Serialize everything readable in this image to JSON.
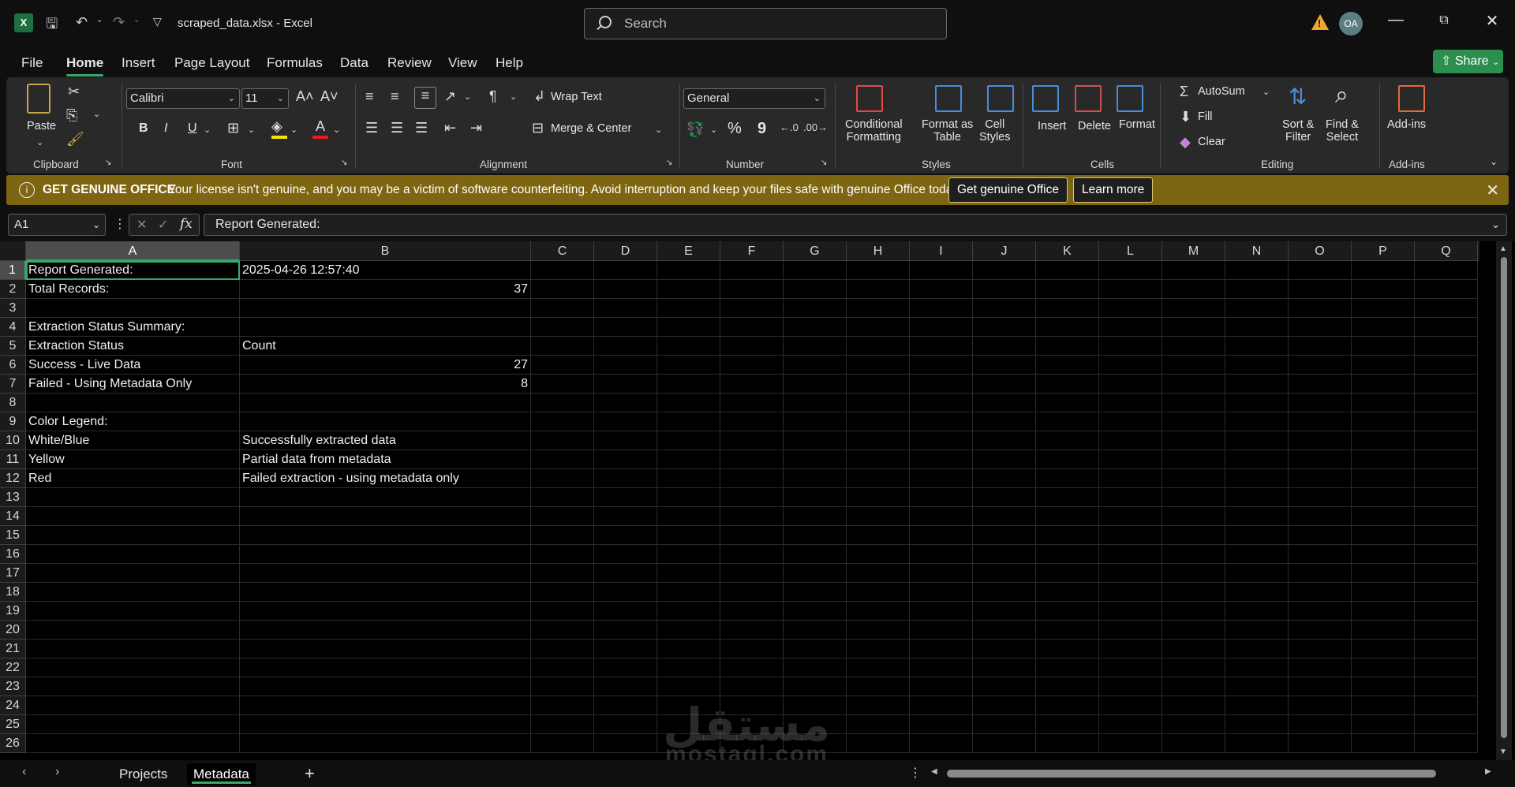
{
  "title": {
    "filename": "scraped_data.xlsx",
    "app": "Excel",
    "separator": "-",
    "search_placeholder": "Search",
    "avatar_initials": "OA"
  },
  "menu": [
    "File",
    "Home",
    "Insert",
    "Page Layout",
    "Formulas",
    "Data",
    "Review",
    "View",
    "Help"
  ],
  "share": "Share",
  "ribbon": {
    "clipboard": {
      "paste": "Paste",
      "label": "Clipboard"
    },
    "font": {
      "name": "Calibri",
      "size": "11",
      "bold": "B",
      "italic": "I",
      "underline": "U",
      "label": "Font"
    },
    "alignment": {
      "wrap": "Wrap Text",
      "merge": "Merge & Center",
      "label": "Alignment"
    },
    "number": {
      "format": "General",
      "percent": "%",
      "comma": "9",
      "label": "Number"
    },
    "styles": {
      "conditional_1": "Conditional",
      "conditional_2": "Formatting",
      "format_table_1": "Format as",
      "format_table_2": "Table",
      "cell_styles_1": "Cell",
      "cell_styles_2": "Styles",
      "label": "Styles"
    },
    "cells": {
      "insert": "Insert",
      "delete": "Delete",
      "format": "Format",
      "label": "Cells"
    },
    "editing": {
      "autosum": "AutoSum",
      "fill": "Fill",
      "clear": "Clear",
      "sort_1": "Sort &",
      "sort_2": "Filter",
      "find_1": "Find &",
      "find_2": "Select",
      "label": "Editing"
    },
    "addins": {
      "label_btn": "Add-ins",
      "label": "Add-ins"
    }
  },
  "banner": {
    "heading": "GET GENUINE OFFICE",
    "message": "Your license isn't genuine, and you may be a victim of software counterfeiting. Avoid interruption and keep your files safe with genuine Office today.",
    "btn_genuine": "Get genuine Office",
    "btn_learn": "Learn more"
  },
  "formula_bar": {
    "cell_ref": "A1",
    "value": "Report Generated:"
  },
  "columns": [
    "A",
    "B",
    "C",
    "D",
    "E",
    "F",
    "G",
    "H",
    "I",
    "J",
    "K",
    "L",
    "M",
    "N",
    "O",
    "P",
    "Q"
  ],
  "rows": [
    {
      "n": "1",
      "a": "Report Generated:",
      "b": "2025-04-26 12:57:40",
      "bnum": false
    },
    {
      "n": "2",
      "a": "Total Records:",
      "b": "37",
      "bnum": true
    },
    {
      "n": "3",
      "a": "",
      "b": "",
      "bnum": false
    },
    {
      "n": "4",
      "a": "Extraction Status Summary:",
      "b": "",
      "bnum": false
    },
    {
      "n": "5",
      "a": "Extraction Status",
      "b": "Count",
      "bnum": false
    },
    {
      "n": "6",
      "a": "Success - Live Data",
      "b": "27",
      "bnum": true
    },
    {
      "n": "7",
      "a": "Failed - Using Metadata Only",
      "b": "8",
      "bnum": true
    },
    {
      "n": "8",
      "a": "",
      "b": "",
      "bnum": false
    },
    {
      "n": "9",
      "a": "Color Legend:",
      "b": "",
      "bnum": false
    },
    {
      "n": "10",
      "a": "White/Blue",
      "b": "Successfully extracted data",
      "bnum": false
    },
    {
      "n": "11",
      "a": "Yellow",
      "b": "Partial data from metadata",
      "bnum": false
    },
    {
      "n": "12",
      "a": "Red",
      "b": "Failed extraction - using metadata only",
      "bnum": false
    },
    {
      "n": "13",
      "a": "",
      "b": "",
      "bnum": false
    },
    {
      "n": "14",
      "a": "",
      "b": "",
      "bnum": false
    },
    {
      "n": "15",
      "a": "",
      "b": "",
      "bnum": false
    },
    {
      "n": "16",
      "a": "",
      "b": "",
      "bnum": false
    },
    {
      "n": "17",
      "a": "",
      "b": "",
      "bnum": false
    },
    {
      "n": "18",
      "a": "",
      "b": "",
      "bnum": false
    },
    {
      "n": "19",
      "a": "",
      "b": "",
      "bnum": false
    },
    {
      "n": "20",
      "a": "",
      "b": "",
      "bnum": false
    },
    {
      "n": "21",
      "a": "",
      "b": "",
      "bnum": false
    },
    {
      "n": "22",
      "a": "",
      "b": "",
      "bnum": false
    },
    {
      "n": "23",
      "a": "",
      "b": "",
      "bnum": false
    },
    {
      "n": "24",
      "a": "",
      "b": "",
      "bnum": false
    },
    {
      "n": "25",
      "a": "",
      "b": "",
      "bnum": false
    },
    {
      "n": "26",
      "a": "",
      "b": "",
      "bnum": false
    }
  ],
  "sheets": [
    "Projects",
    "Metadata"
  ],
  "active_sheet": "Metadata",
  "watermark": {
    "arabic": "مستقل",
    "latin": "mostaql.com"
  },
  "colors": {
    "accent": "#3aa76d",
    "banner": "#7d6512",
    "warning": "#f0a732"
  }
}
